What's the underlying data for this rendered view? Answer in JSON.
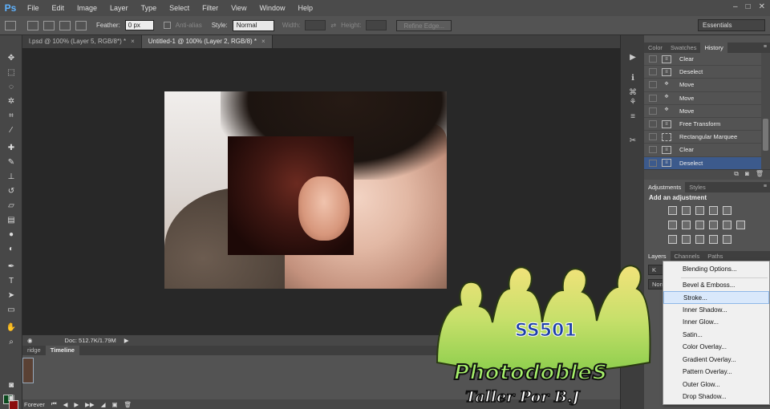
{
  "app": {
    "logo": "Ps"
  },
  "menu": [
    "File",
    "Edit",
    "Image",
    "Layer",
    "Type",
    "Select",
    "Filter",
    "View",
    "Window",
    "Help"
  ],
  "options": {
    "feather_label": "Feather:",
    "feather_value": "0 px",
    "antialias_label": "Anti-alias",
    "style_label": "Style:",
    "style_value": "Normal",
    "width_label": "Width:",
    "height_label": "Height:",
    "refine_label": "Refine Edge...",
    "workspace": "Essentials"
  },
  "doc_tabs": [
    {
      "label": "l.psd @ 100% (Layer 5, RGB/8*) *",
      "active": false
    },
    {
      "label": "Untitled-1 @ 100% (Layer 2, RGB/8) *",
      "active": true
    }
  ],
  "status": {
    "zoom": "100%",
    "doc_info": "Doc: 512.7K/1.79M"
  },
  "bottom_tabs": [
    "ridge",
    "Timeline"
  ],
  "timeline": {
    "loop": "Forever"
  },
  "history": {
    "tabs": [
      "Color",
      "Swatches",
      "History"
    ],
    "items": [
      {
        "label": "Clear",
        "icon": "document-icon"
      },
      {
        "label": "Deselect",
        "icon": "document-icon"
      },
      {
        "label": "Move",
        "icon": "move-icon"
      },
      {
        "label": "Move",
        "icon": "move-icon"
      },
      {
        "label": "Move",
        "icon": "move-icon"
      },
      {
        "label": "Free Transform",
        "icon": "document-icon"
      },
      {
        "label": "Rectangular Marquee",
        "icon": "marquee-icon"
      },
      {
        "label": "Clear",
        "icon": "document-icon"
      },
      {
        "label": "Deselect",
        "icon": "document-icon",
        "selected": true
      }
    ]
  },
  "adjustments": {
    "tabs": [
      "Adjustments",
      "Styles"
    ],
    "title": "Add an adjustment"
  },
  "layers": {
    "tabs": [
      "Layers",
      "Channels",
      "Paths"
    ],
    "kind": "K",
    "blend": "Norm"
  },
  "context_menu": {
    "items": [
      "Blending Options...",
      "Bevel & Emboss...",
      "Stroke...",
      "Inner Shadow...",
      "Inner Glow...",
      "Satin...",
      "Color Overlay...",
      "Gradient Overlay...",
      "Pattern Overlay...",
      "Outer Glow...",
      "Drop Shadow..."
    ],
    "highlighted": "Stroke..."
  },
  "watermark": {
    "logo": "SS501",
    "title": "PhotodobleS",
    "subtitle": "Taller Por B.J"
  },
  "colors": {
    "foreground": "#0b4a1e",
    "background": "#8b0c0c",
    "selection": "#3c5a8c"
  }
}
